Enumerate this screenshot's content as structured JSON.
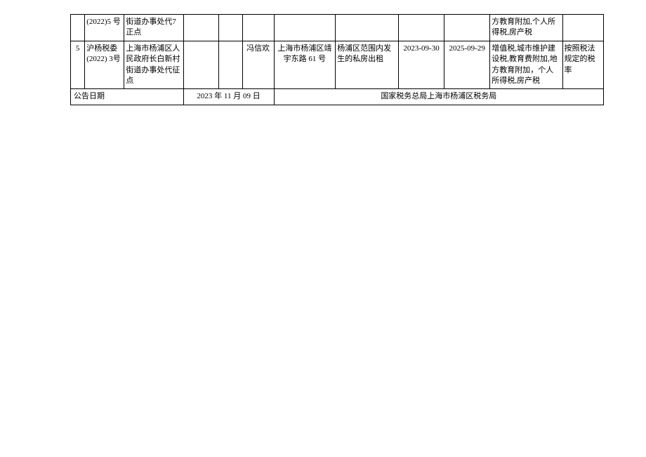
{
  "rows": [
    {
      "seq": "",
      "doc_no": "(2022)5 号",
      "entity": "街道办事处代7 正点",
      "col_e1": "",
      "col_e2": "",
      "person": "",
      "address": "",
      "scope": "",
      "date_start": "",
      "date_end": "",
      "taxes": "方教育附加,个人所得税,房产税",
      "rate": ""
    },
    {
      "seq": "5",
      "doc_no": "沪杨税委(2022) 3号",
      "entity": "上海市杨浦区人民政府长白新村街道办事处代征点",
      "col_e1": "",
      "col_e2": "",
      "person": "冯信欢",
      "address": "上海市杨浦区靖宇东路 61 号",
      "scope": "杨浦区范围内发生的私房出租",
      "date_start": "2023-09-30",
      "date_end": "2025-09-29",
      "taxes": "增值税,城市维护建设税,教育费附加,地方教育附加，个人所得税,房产税",
      "rate": "按照税法规定的税率"
    }
  ],
  "footer": {
    "label": "公告日期",
    "date": "2023 年 11 月 09 日",
    "org": "国家税务总局上海市杨浦区税务局"
  }
}
